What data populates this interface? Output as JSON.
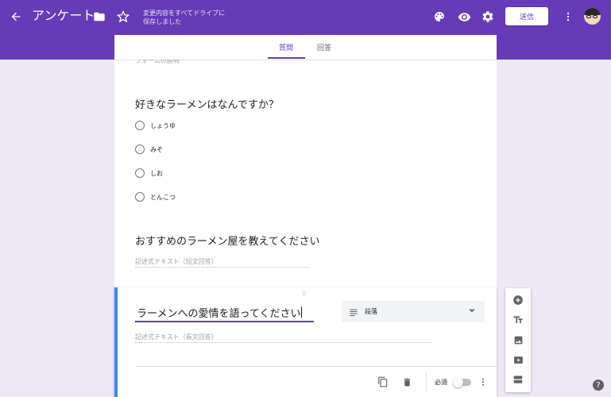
{
  "header": {
    "form_title": "アンケート",
    "save_status": "変更内容をすべてドライブに保存しました",
    "send_label": "送信",
    "accent_color": "#673ab7"
  },
  "tabs": [
    {
      "label": "質問",
      "active": true
    },
    {
      "label": "回答",
      "active": false
    }
  ],
  "form_description": "フォームの説明",
  "questions": [
    {
      "title": "好きなラーメンはなんですか？",
      "options": [
        "しょうゆ",
        "みそ",
        "しお",
        "とんこつ"
      ]
    },
    {
      "title": "おすすめのラーメン屋を教えてください",
      "answer_placeholder": "記述式テキスト（短文回答）"
    }
  ],
  "active_question": {
    "title": "ラーメンへの愛情を語ってください",
    "type_label": "段落",
    "answer_placeholder": "記述式テキスト（長文回答）",
    "required_label": "必須",
    "required": false
  },
  "icons": {
    "back": "arrow-back-icon",
    "folder": "folder-icon",
    "star": "star-icon",
    "palette": "palette-icon",
    "preview": "eye-icon",
    "settings": "gear-icon",
    "more": "more-vert-icon"
  },
  "help_label": "?"
}
